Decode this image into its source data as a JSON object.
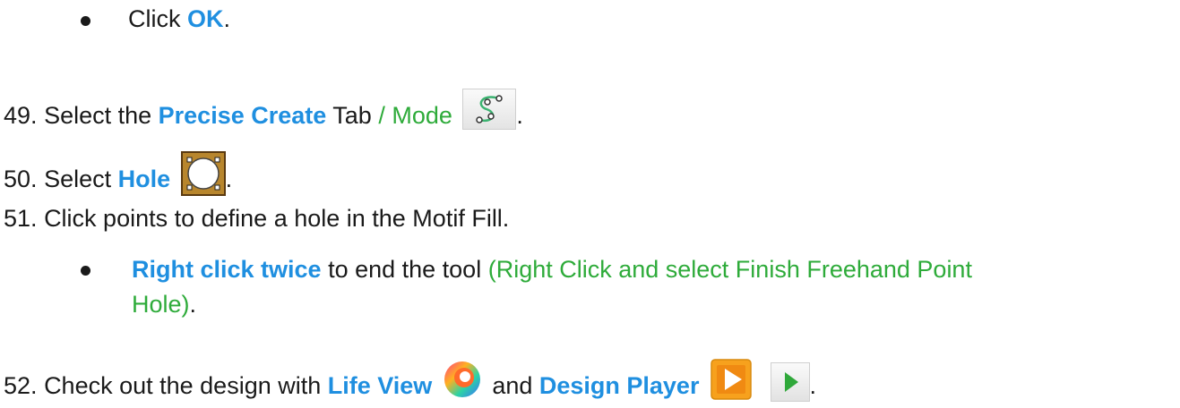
{
  "items": {
    "b1": {
      "pre": "Click ",
      "emph": "OK",
      "post": "."
    },
    "s49": {
      "num": "49.",
      "pre": "Select the ",
      "emph": "Precise Create",
      "mid": " Tab",
      "green": " / Mode",
      "post": "."
    },
    "s50": {
      "num": "50.",
      "pre": "Select ",
      "emph": "Hole",
      "post": "."
    },
    "s51": {
      "num": "51.",
      "text": "Click points to define a hole in the Motif Fill."
    },
    "b2": {
      "emph": "Right click twice",
      "mid": " to end the tool ",
      "green1": "(Right Click and select Finish Freehand Point",
      "green2": "Hole)",
      "post": "."
    },
    "s52": {
      "num": "52.",
      "pre": "Check out the design with ",
      "emph1": "Life View",
      "mid": " and ",
      "emph2": "Design Player",
      "post": "."
    }
  },
  "icons": {
    "mode": "precise-create-mode-icon",
    "hole": "hole-icon",
    "life": "life-view-icon",
    "player": "design-player-icon",
    "play": "play-icon"
  },
  "colors": {
    "emphasis": "#1f8fe0",
    "secondary": "#2eab3a",
    "hole_bg": "#b8862d"
  }
}
